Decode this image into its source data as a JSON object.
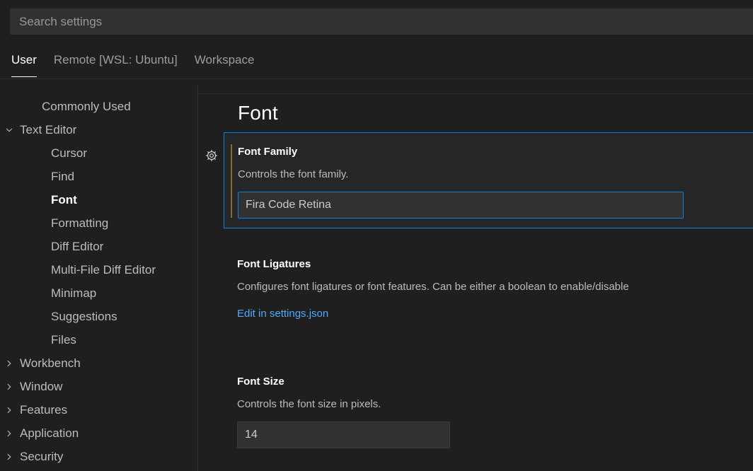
{
  "search": {
    "placeholder": "Search settings",
    "value": ""
  },
  "tabs": [
    {
      "label": "User",
      "active": true
    },
    {
      "label": "Remote [WSL: Ubuntu]",
      "active": false
    },
    {
      "label": "Workspace",
      "active": false
    }
  ],
  "sidebar": {
    "items": [
      {
        "label": "Commonly Used",
        "level": 0,
        "chevron": "none",
        "selected": false
      },
      {
        "label": "Text Editor",
        "level": 0,
        "chevron": "down",
        "selected": false
      },
      {
        "label": "Cursor",
        "level": 1,
        "chevron": "none",
        "selected": false
      },
      {
        "label": "Find",
        "level": 1,
        "chevron": "none",
        "selected": false
      },
      {
        "label": "Font",
        "level": 1,
        "chevron": "none",
        "selected": true
      },
      {
        "label": "Formatting",
        "level": 1,
        "chevron": "none",
        "selected": false
      },
      {
        "label": "Diff Editor",
        "level": 1,
        "chevron": "none",
        "selected": false
      },
      {
        "label": "Multi-File Diff Editor",
        "level": 1,
        "chevron": "none",
        "selected": false
      },
      {
        "label": "Minimap",
        "level": 1,
        "chevron": "none",
        "selected": false
      },
      {
        "label": "Suggestions",
        "level": 1,
        "chevron": "none",
        "selected": false
      },
      {
        "label": "Files",
        "level": 1,
        "chevron": "none",
        "selected": false
      },
      {
        "label": "Workbench",
        "level": 0,
        "chevron": "right",
        "selected": false
      },
      {
        "label": "Window",
        "level": 0,
        "chevron": "right",
        "selected": false
      },
      {
        "label": "Features",
        "level": 0,
        "chevron": "right",
        "selected": false
      },
      {
        "label": "Application",
        "level": 0,
        "chevron": "right",
        "selected": false
      },
      {
        "label": "Security",
        "level": 0,
        "chevron": "right",
        "selected": false
      }
    ]
  },
  "main": {
    "title": "Font",
    "settings": {
      "font_family": {
        "label": "Font Family",
        "description": "Controls the font family.",
        "value": "Fira Code Retina",
        "gear_icon": "gear-icon",
        "modified": true,
        "focused": true
      },
      "font_ligatures": {
        "label": "Font Ligatures",
        "description": "Configures font ligatures or font features. Can be either a boolean to enable/disable",
        "link": "Edit in settings.json"
      },
      "font_size": {
        "label": "Font Size",
        "description": "Controls the font size in pixels.",
        "value": "14"
      }
    }
  },
  "colors": {
    "background": "#1f1f1f",
    "row_focused_background": "#252628",
    "focus_border": "#0a84d8",
    "modified_indicator": "#8a6a1e",
    "link": "#4daafc",
    "input_background": "#313131"
  }
}
